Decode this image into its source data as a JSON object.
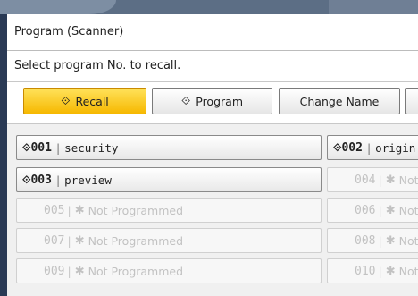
{
  "window": {
    "title": "Program (Scanner)"
  },
  "instruction": "Select program No. to recall.",
  "toolbar": {
    "recall_label": "Recall",
    "program_label": "Program",
    "change_name_label": "Change Name",
    "active": "recall"
  },
  "programs": [
    {
      "num": "001",
      "name": "security",
      "programmed": true
    },
    {
      "num": "002",
      "name": "origin",
      "programmed": true
    },
    {
      "num": "003",
      "name": "preview",
      "programmed": true
    },
    {
      "num": "004",
      "name": "Not",
      "programmed": false
    },
    {
      "num": "005",
      "name": "Not Programmed",
      "programmed": false
    },
    {
      "num": "006",
      "name": "Not",
      "programmed": false
    },
    {
      "num": "007",
      "name": "Not Programmed",
      "programmed": false
    },
    {
      "num": "008",
      "name": "Not",
      "programmed": false
    },
    {
      "num": "009",
      "name": "Not Programmed",
      "programmed": false
    },
    {
      "num": "010",
      "name": "Not",
      "programmed": false
    }
  ],
  "icons": {
    "program": "diamond-arrow-icon",
    "not_programmed": "asterisk-icon"
  },
  "colors": {
    "active_button": "#f6b800",
    "frame": "#2a3a55"
  }
}
